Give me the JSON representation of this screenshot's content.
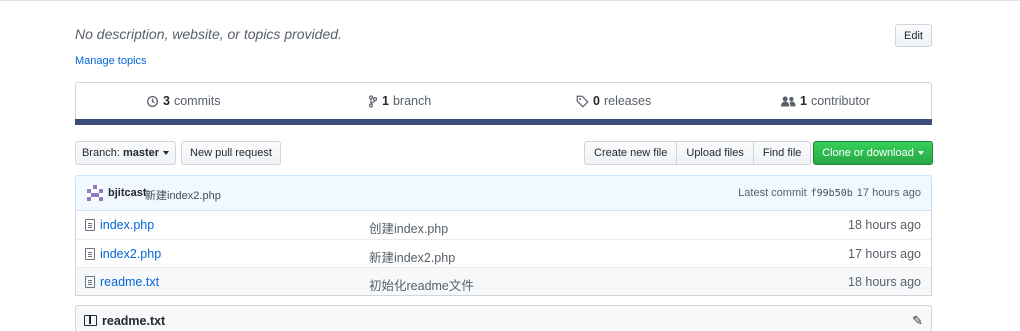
{
  "repo": {
    "description": "No description, website, or topics provided.",
    "manage_topics": "Manage topics",
    "edit_label": "Edit"
  },
  "numbers": {
    "commits_count": "3",
    "commits_label": "commits",
    "branch_count": "1",
    "branch_label": "branch",
    "releases_count": "0",
    "releases_label": "releases",
    "contributor_count": "1",
    "contributor_label": "contributor"
  },
  "toolbar": {
    "branch_prefix": "Branch:",
    "branch_name": "master",
    "new_pr": "New pull request",
    "create_file": "Create new file",
    "upload_files": "Upload files",
    "find_file": "Find file",
    "clone": "Clone or download"
  },
  "commit": {
    "author": "bjitcast",
    "message": "新建index2.php",
    "latest_label": "Latest commit",
    "sha": "f99b50b",
    "age": "17 hours ago"
  },
  "files": [
    {
      "name": "index.php",
      "message": "创建index.php",
      "age": "18 hours ago"
    },
    {
      "name": "index2.php",
      "message": "新建index2.php",
      "age": "17 hours ago"
    },
    {
      "name": "readme.txt",
      "message": "初始化readme文件",
      "age": "18 hours ago"
    }
  ],
  "readme": {
    "title": "readme.txt"
  },
  "colors": {
    "accent": "#0366d6",
    "clone_button": "#28a745",
    "language_bar": "#3f4d7a"
  },
  "icons": {
    "commits": "history-icon",
    "branch": "branch-icon",
    "releases": "tag-icon",
    "contributors": "people-icon",
    "file": "file-icon",
    "readme": "book-icon",
    "edit": "pencil-icon"
  }
}
